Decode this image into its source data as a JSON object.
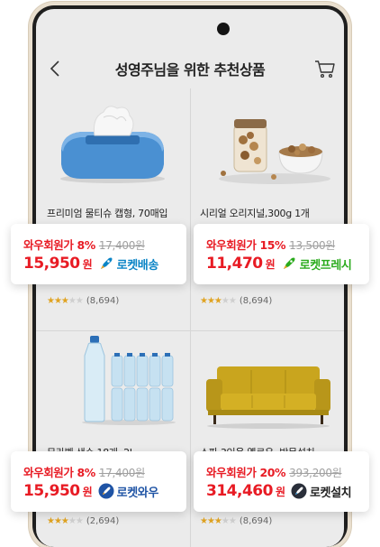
{
  "header": {
    "title": "성영주님을 위한 추천상품"
  },
  "products": [
    {
      "name": "프리미엄 물티슈 캡형, 70매입",
      "reviews": "(8,694)",
      "rating": 3.5,
      "discount": "와우회원가 8%",
      "original": "17,400원",
      "price": "15,950",
      "won": "원",
      "badge": "로켓배송",
      "badge_color": "#0a84c6",
      "badge_icon": "rocket-icon"
    },
    {
      "name": "시리얼 오리지널,300g 1개",
      "reviews": "(8,694)",
      "rating": 3.5,
      "discount": "와우회원가 15%",
      "original": "13,500원",
      "price": "11,470",
      "won": "원",
      "badge": "로켓프레시",
      "badge_color": "#2bab1d",
      "badge_icon": "rocket-icon"
    },
    {
      "name": "무라벨 생수 18개, 2L",
      "reviews": "(2,694)",
      "rating": 3.5,
      "discount": "와우회원가 8%",
      "original": "17,400원",
      "price": "15,950",
      "won": "원",
      "badge": "로켓와우",
      "badge_color": "#1f54a5",
      "badge_icon": "rocket-wow-icon"
    },
    {
      "name": "소파 3인용 옐로우, 방문설치",
      "reviews": "(8,694)",
      "rating": 3.5,
      "discount": "와우회원가 20%",
      "original": "393,200원",
      "price": "314,460",
      "won": "원",
      "badge": "로켓설치",
      "badge_color": "#222222",
      "badge_icon": "rocket-install-icon"
    }
  ],
  "colors": {
    "accent": "#e81b24",
    "background": "#ebebeb"
  }
}
